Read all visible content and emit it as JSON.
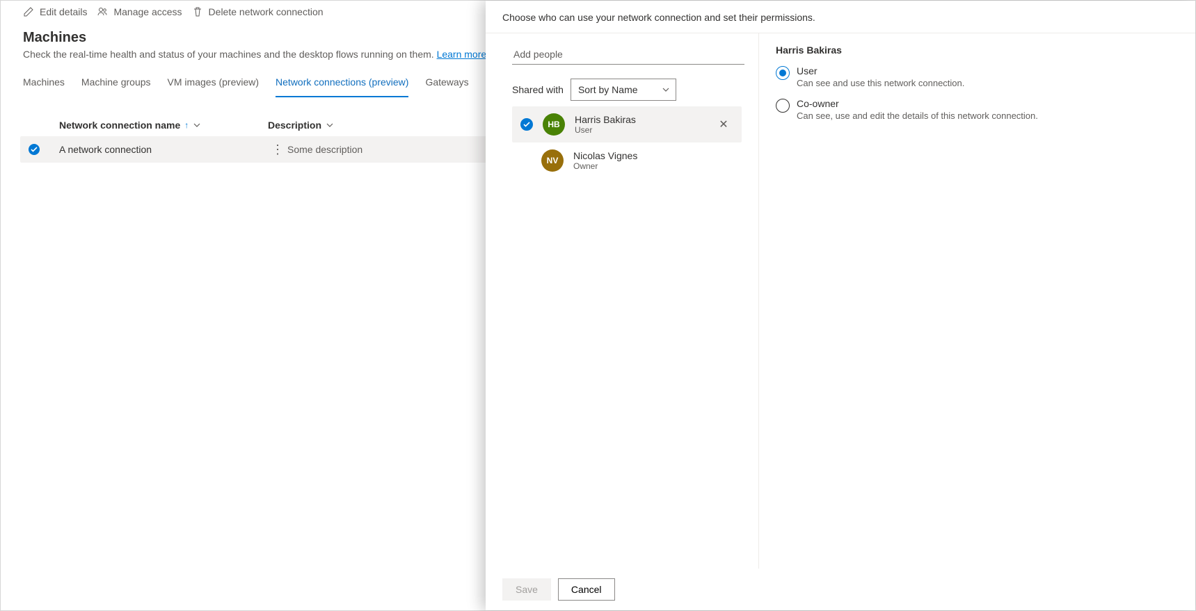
{
  "commands": {
    "edit": "Edit details",
    "manage": "Manage access",
    "delete": "Delete network connection"
  },
  "page": {
    "title": "Machines",
    "subtitle": "Check the real-time health and status of your machines and the desktop flows running on them. ",
    "learn_more": "Learn more"
  },
  "tabs": [
    {
      "label": "Machines"
    },
    {
      "label": "Machine groups"
    },
    {
      "label": "VM images (preview)"
    },
    {
      "label": "Network connections (preview)"
    },
    {
      "label": "Gateways"
    }
  ],
  "grid": {
    "col_name": "Network connection name",
    "col_desc": "Description",
    "row": {
      "name": "A network connection",
      "desc": "Some description"
    }
  },
  "panel": {
    "title": "Choose who can use your network connection and set their permissions.",
    "add_placeholder": "Add people",
    "shared_with_label": "Shared with",
    "sort_value": "Sort by Name",
    "people": [
      {
        "name": "Harris Bakiras",
        "role": "User",
        "initials": "HB",
        "color": "#498205",
        "selected": true,
        "removable": true
      },
      {
        "name": "Nicolas Vignes",
        "role": "Owner",
        "initials": "NV",
        "color": "#986f0b",
        "selected": false,
        "removable": false
      }
    ],
    "selected_person": "Harris Bakiras",
    "permissions": [
      {
        "label": "User",
        "desc": "Can see and use this network connection.",
        "selected": true
      },
      {
        "label": "Co-owner",
        "desc": "Can see, use and edit the details of this network connection.",
        "selected": false
      }
    ],
    "save": "Save",
    "cancel": "Cancel"
  }
}
